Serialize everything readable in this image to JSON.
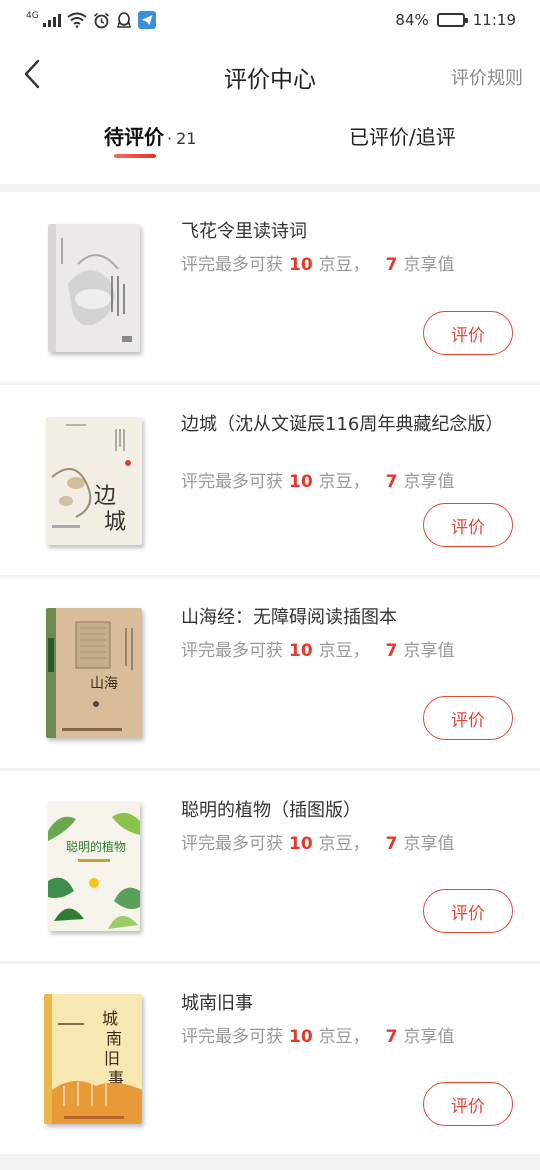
{
  "status_bar": {
    "network": "4G",
    "battery": "84%",
    "battery_level": 0.84,
    "time": "11:19"
  },
  "header": {
    "title": "评价中心",
    "rules": "评价规则",
    "back_icon": "chevron-left-icon"
  },
  "tabs": {
    "pending_label": "待评价",
    "pending_dot": "·",
    "pending_count": "21",
    "done_label": "已评价/追评",
    "accent": "#e4392b"
  },
  "reward": {
    "prefix": "评完最多可获",
    "jingdou_value": "10",
    "jingdou_unit": "京豆，",
    "xiangzhi_value": "7",
    "xiangzhi_unit": "京享值"
  },
  "items": [
    {
      "title": "飞花令里读诗词",
      "button": "评价"
    },
    {
      "title": "边城（沈从文诞辰116周年典藏纪念版）",
      "button": "评价"
    },
    {
      "title": "山海经：无障碍阅读插图本",
      "button": "评价"
    },
    {
      "title": "聪明的植物（插图版）",
      "button": "评价"
    },
    {
      "title": "城南旧事",
      "button": "评价"
    }
  ]
}
